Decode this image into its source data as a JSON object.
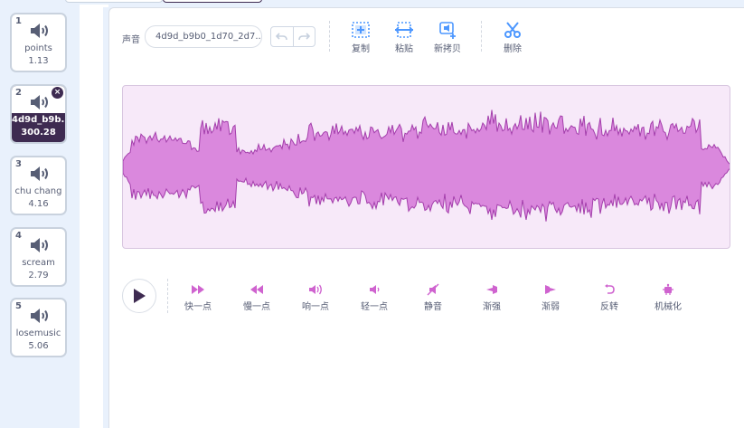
{
  "sounds": [
    {
      "index": "1",
      "name": "points",
      "duration": "1.13"
    },
    {
      "index": "2",
      "name": "4d9d_b9b...",
      "duration": "300.28"
    },
    {
      "index": "3",
      "name": "chu chang",
      "duration": "4.16"
    },
    {
      "index": "4",
      "name": "scream",
      "duration": "2.79"
    },
    {
      "index": "5",
      "name": "losemusic",
      "duration": "5.06"
    }
  ],
  "selected_index": 2,
  "editor": {
    "sound_label": "声音",
    "sound_name_value": "4d9d_b9b0_1d70_2d7...",
    "toolbar": {
      "copy": "复制",
      "paste": "粘贴",
      "copy_new": "新拷贝",
      "delete": "删除"
    },
    "effects": {
      "faster": "快一点",
      "slower": "慢一点",
      "louder": "响一点",
      "softer": "轻一点",
      "mute": "静音",
      "fade_in": "渐强",
      "fade_out": "渐弱",
      "reverse": "反转",
      "robot": "机械化"
    }
  },
  "colors": {
    "accent": "#4c97ff",
    "waveform_fill": "#da88dd",
    "waveform_stroke": "#a33eab",
    "waveform_bg": "#f7e9f9",
    "effect_icon": "#cf63cf",
    "selected_tile": "#3e2b51"
  }
}
